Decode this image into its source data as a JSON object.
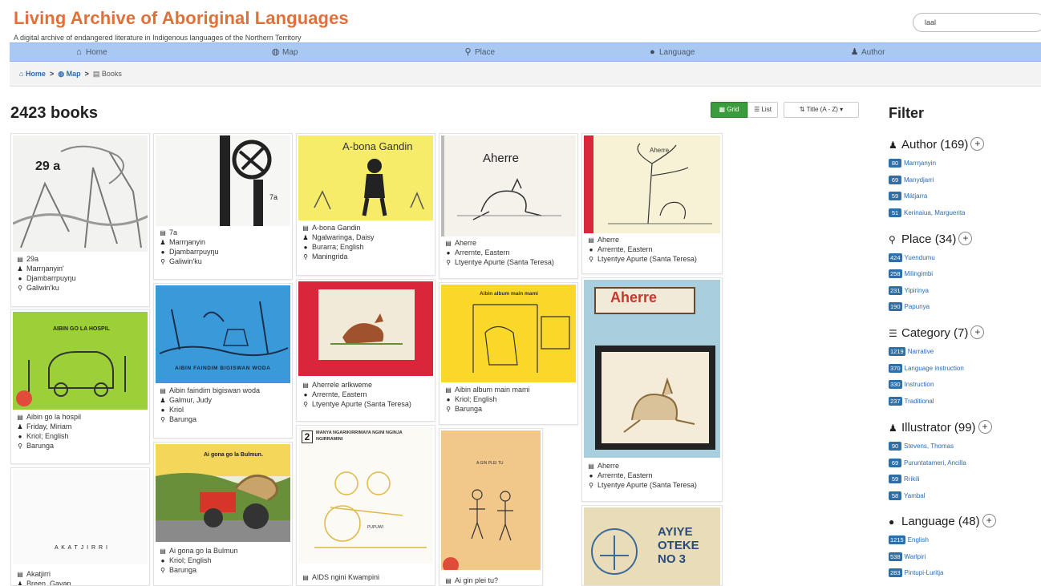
{
  "header": {
    "title": "Living Archive of Aboriginal Languages",
    "subtitle": "A digital archive of endangered literature in Indigenous languages of the Northern Territory",
    "search_value": "laal"
  },
  "nav": [
    {
      "label": "Home",
      "icon": "home-icon"
    },
    {
      "label": "Map",
      "icon": "globe-icon"
    },
    {
      "label": "Place",
      "icon": "map-marker-icon"
    },
    {
      "label": "Language",
      "icon": "speech-bubble-icon"
    },
    {
      "label": "Author",
      "icon": "person-icon"
    }
  ],
  "breadcrumb": {
    "home": "Home",
    "map": "Map",
    "current": "Books"
  },
  "results": {
    "count": "2423 books"
  },
  "view": {
    "grid": "Grid",
    "list": "List",
    "sort": "Title (A - Z)"
  },
  "books": [
    {
      "title": "29a",
      "author": "Marrŋanyin'",
      "language": "Djambarrpuyŋu",
      "place": "Galiwin'ku",
      "cover_label": "29 a"
    },
    {
      "title": "Aibin go la hospil",
      "author": "Friday, Miriam",
      "language": "Kriol; English",
      "place": "Barunga",
      "cover_label": "AIBIN GO LA HOSPIL"
    },
    {
      "title": "Akatjirri",
      "author": "Breen, Gavan",
      "cover_label": "A K A T J I R R I"
    },
    {
      "title": "7a",
      "author": "Marrŋanyin",
      "language": "Djambarrpuyŋu",
      "place": "Galiwin'ku",
      "cover_label": "7a"
    },
    {
      "title": "Aibin faindim bigiswan woda",
      "author": "Galmur, Judy",
      "language": "Kriol",
      "place": "Barunga",
      "cover_label": "AIBIN FAINDIM BIGISWAN WODA"
    },
    {
      "title": "Ai gona go la Bulmun",
      "language": "Kriol; English",
      "place": "Barunga",
      "cover_label": "Ai gona go la Bulmun."
    },
    {
      "title": "A-bona Gandin",
      "author": "Ngalwaringa, Daisy",
      "language": "Burarra; English",
      "place": "Maningrida",
      "cover_label": "A-bona Gandin"
    },
    {
      "title": "Aherrele arlkweme",
      "language": "Arrernte, Eastern",
      "place": "Ltyentye Apurte (Santa Teresa)"
    },
    {
      "title": "AIDS ngini Kwampini",
      "cover_label": "MANYA NGARIKIRRIMAYA NGINI NGINJA NGIRRAMINI",
      "cover_number": "2",
      "cover_caption": "PUPUWI"
    },
    {
      "title": "Aherre",
      "language": "Arrernte, Eastern",
      "place": "Ltyentye Apurte (Santa Teresa)",
      "cover_label": "Aherre"
    },
    {
      "title": "Aibin album main mami",
      "language": "Kriol; English",
      "place": "Barunga",
      "cover_label": "Aibin album main mami"
    },
    {
      "title": "Ai gin plei tu?",
      "cover_label": "A GIN PLEI TU"
    },
    {
      "title": "Aherre",
      "language": "Arrernte, Eastern",
      "place": "Ltyentye Apurte (Santa Teresa)",
      "cover_label": "Aherre"
    },
    {
      "title": "Aherre",
      "language": "Arrernte, Eastern",
      "place": "Ltyentye Apurte (Santa Teresa)",
      "cover_label": "Aherre"
    },
    {
      "title": "Ayiye oteke no 3",
      "cover_label": "AYIYE OTEKE NO 3"
    }
  ],
  "filter": {
    "title": "Filter",
    "groups": [
      {
        "label": "Author (169)",
        "icon": "person-icon",
        "items": [
          {
            "count": "80",
            "name": "Marrŋanyin"
          },
          {
            "count": "69",
            "name": "Manydjarri"
          },
          {
            "count": "59",
            "name": "Mätjarra"
          },
          {
            "count": "51",
            "name": "Kerinaiua, Marguerita"
          }
        ]
      },
      {
        "label": "Place (34)",
        "icon": "map-marker-icon",
        "items": [
          {
            "count": "424",
            "name": "Yuendumu"
          },
          {
            "count": "258",
            "name": "Milingimbi"
          },
          {
            "count": "231",
            "name": "Yipirinya"
          },
          {
            "count": "190",
            "name": "Papunya"
          }
        ]
      },
      {
        "label": "Category (7)",
        "icon": "list-icon",
        "items": [
          {
            "count": "1219",
            "name": "Narrative"
          },
          {
            "count": "370",
            "name": "Language instruction"
          },
          {
            "count": "330",
            "name": "Instruction"
          },
          {
            "count": "237",
            "name": "Traditional"
          }
        ]
      },
      {
        "label": "Illustrator (99)",
        "icon": "person-icon",
        "items": [
          {
            "count": "90",
            "name": "Stevens, Thomas"
          },
          {
            "count": "69",
            "name": "Puruntatameri, Ancilla"
          },
          {
            "count": "59",
            "name": "Rrikili"
          },
          {
            "count": "58",
            "name": "Yambal"
          }
        ]
      },
      {
        "label": "Language (48)",
        "icon": "speech-bubble-icon",
        "items": [
          {
            "count": "1215",
            "name": "English"
          },
          {
            "count": "538",
            "name": "Warlpiri"
          },
          {
            "count": "283",
            "name": "Pintupi-Luritja"
          }
        ]
      }
    ]
  },
  "colors": {
    "title": "#e0703a",
    "nav_bg": "#a9c8f2",
    "link": "#2a6bb5",
    "grid_btn": "#3b9c3b",
    "badge": "#2f6fa8"
  }
}
